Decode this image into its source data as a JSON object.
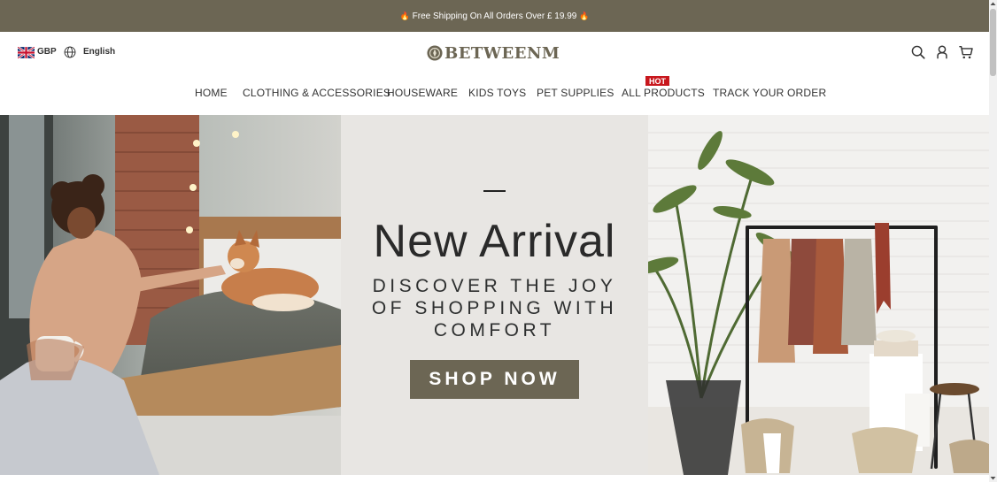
{
  "announcement": {
    "left_emoji": "🔥",
    "text": "Free Shipping On All Orders Over £ 19.99",
    "right_emoji": "🔥"
  },
  "header": {
    "currency": "GBP",
    "language": "English",
    "logo_text": "BETWEENM",
    "icons": [
      "flag-uk-icon",
      "globe-icon",
      "search-icon",
      "user-icon",
      "cart-icon"
    ]
  },
  "nav": {
    "items": [
      {
        "label": "HOME"
      },
      {
        "label": "CLOTHING & ACCESSORIES"
      },
      {
        "label": "HOUSEWARE"
      },
      {
        "label": "KIDS TOYS"
      },
      {
        "label": "PET SUPPLIES"
      },
      {
        "label": "ALL PRODUCTS",
        "badge": "HOT"
      },
      {
        "label": "TRACK YOUR ORDER"
      }
    ]
  },
  "hero": {
    "title": "New Arrival",
    "subtitle_lines": [
      "DISCOVER THE JOY",
      "OF SHOPPING WITH",
      "COMFORT"
    ],
    "button_label": "SHOP NOW"
  },
  "colors": {
    "brand": "#6c6654",
    "hot_badge": "#c8171d",
    "hero_panel": "#e8e6e3",
    "text": "#333333"
  }
}
